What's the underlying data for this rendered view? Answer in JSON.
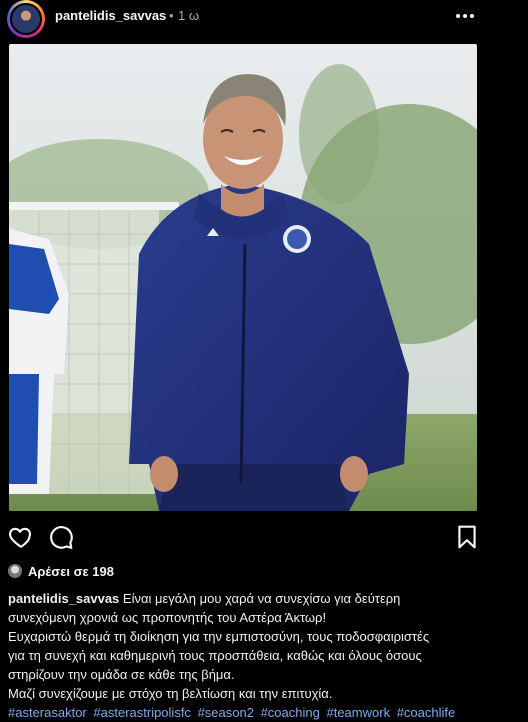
{
  "post": {
    "username": "pantelidis_savvas",
    "separator": "•",
    "time": "1 ω",
    "likes_text": "Αρέσει σε 198",
    "caption": {
      "username": "pantelidis_savvas",
      "lines": [
        "Είναι μεγάλη μου χαρά να συνεχίσω για δεύτερη",
        "συνεχόμενη χρονιά ως προπονητής του Αστέρα Άκτωρ!",
        "Ευχαριστώ θερμά τη διοίκηση για την εμπιστοσύνη, τους ποδοσφαιριστές",
        "για τη συνεχή και καθημερινή τους προσπάθεια, καθώς και όλους όσους",
        "στηρίζουν την ομάδα σε κάθε της βήμα.",
        "Μαζί συνεχίζουμε με στόχο τη βελτίωση και την επιτυχία."
      ],
      "hashtags": [
        "#asterasaktor",
        "#asterastripolisfc",
        "#season2",
        "#coaching",
        "#teamwork",
        "#coachlife"
      ]
    }
  },
  "icons": {
    "more": "more-options-icon",
    "like": "heart-icon",
    "comment": "comment-icon",
    "save": "bookmark-icon"
  },
  "colors": {
    "background": "#000000",
    "text": "#f5f5f5",
    "secondary_text": "#a8a8a8",
    "hashtag": "#7ea8f0"
  }
}
